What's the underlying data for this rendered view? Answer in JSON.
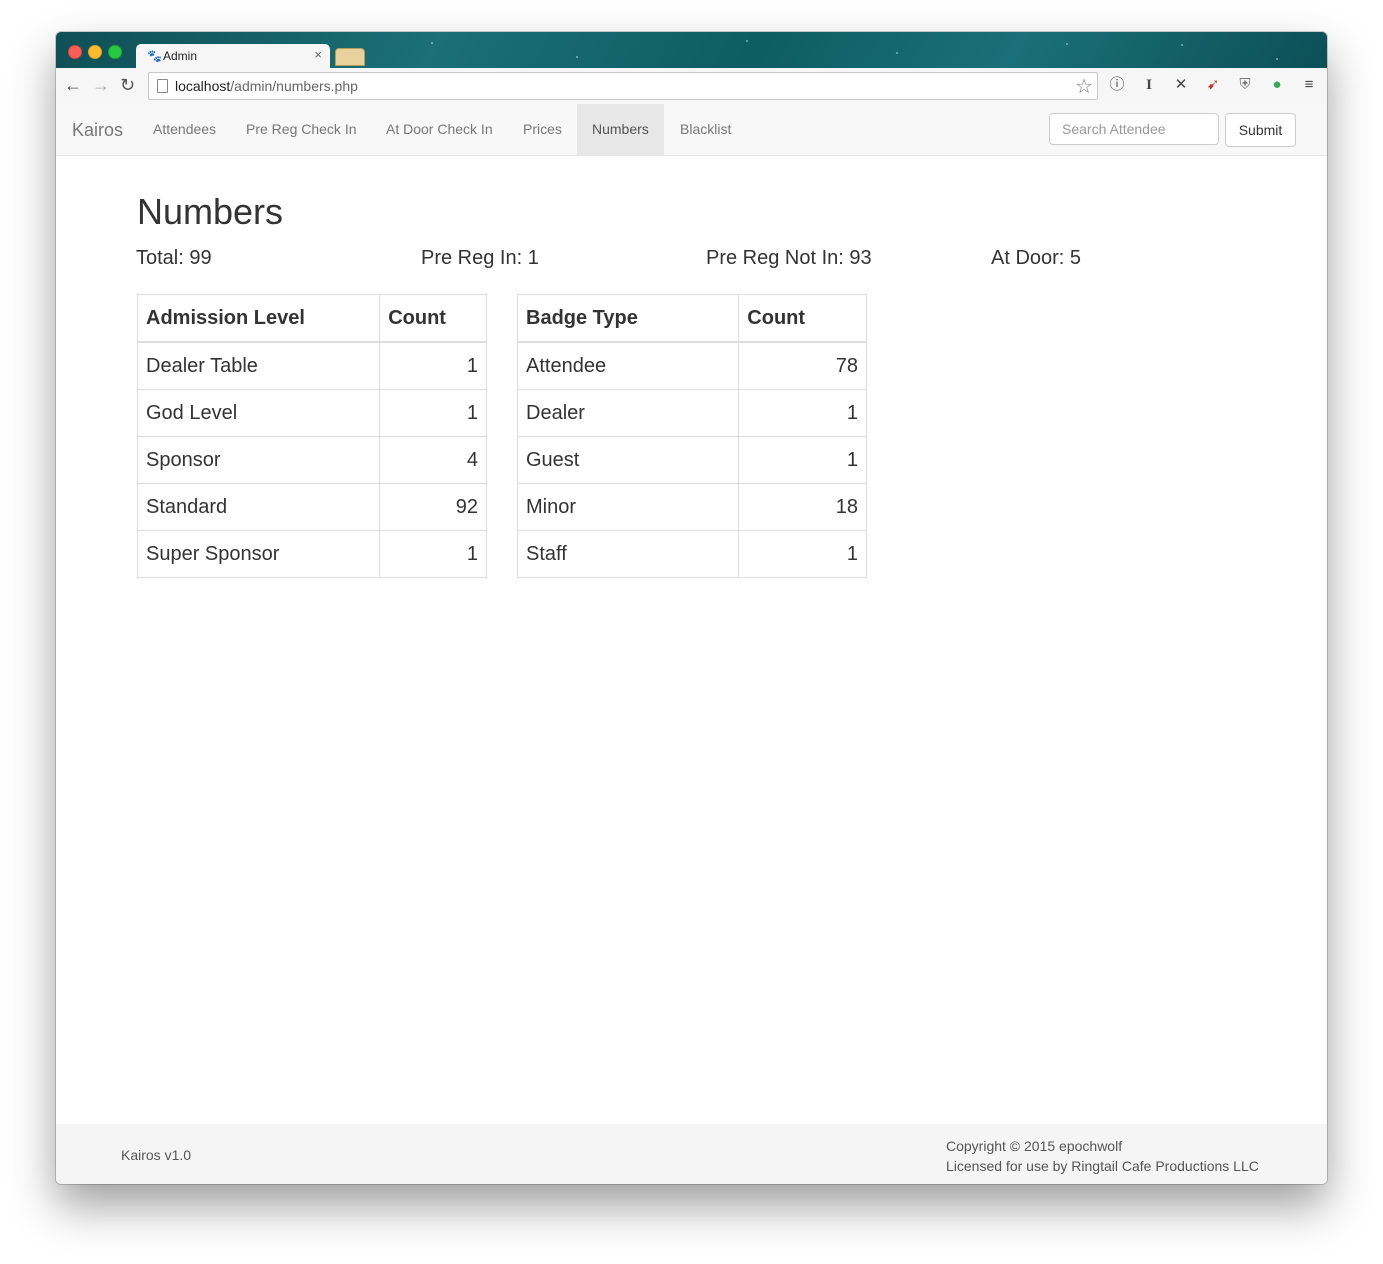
{
  "browser": {
    "tab_title": "Admin",
    "tab_close": "×",
    "url_host": "localhost",
    "url_path": "/admin/numbers.php"
  },
  "navbar": {
    "brand": "Kairos",
    "items": [
      {
        "label": "Attendees",
        "active": false
      },
      {
        "label": "Pre Reg Check In",
        "active": false
      },
      {
        "label": "At Door Check In",
        "active": false
      },
      {
        "label": "Prices",
        "active": false
      },
      {
        "label": "Numbers",
        "active": true
      },
      {
        "label": "Blacklist",
        "active": false
      }
    ],
    "search_placeholder": "Search Attendee",
    "submit_label": "Submit"
  },
  "page": {
    "title": "Numbers",
    "stats": {
      "total": "Total: 99",
      "pre_reg_in": "Pre Reg In: 1",
      "pre_reg_not_in": "Pre Reg Not In: 93",
      "at_door": "At Door: 5"
    },
    "admission_table": {
      "headers": [
        "Admission Level",
        "Count"
      ],
      "rows": [
        [
          "Dealer Table",
          "1"
        ],
        [
          "God Level",
          "1"
        ],
        [
          "Sponsor",
          "4"
        ],
        [
          "Standard",
          "92"
        ],
        [
          "Super Sponsor",
          "1"
        ]
      ]
    },
    "badge_table": {
      "headers": [
        "Badge Type",
        "Count"
      ],
      "rows": [
        [
          "Attendee",
          "78"
        ],
        [
          "Dealer",
          "1"
        ],
        [
          "Guest",
          "1"
        ],
        [
          "Minor",
          "18"
        ],
        [
          "Staff",
          "1"
        ]
      ]
    }
  },
  "footer": {
    "version": "Kairos v1.0",
    "copyright": "Copyright © 2015 epochwolf",
    "license": "Licensed for use by Ringtail Cafe Productions LLC"
  }
}
